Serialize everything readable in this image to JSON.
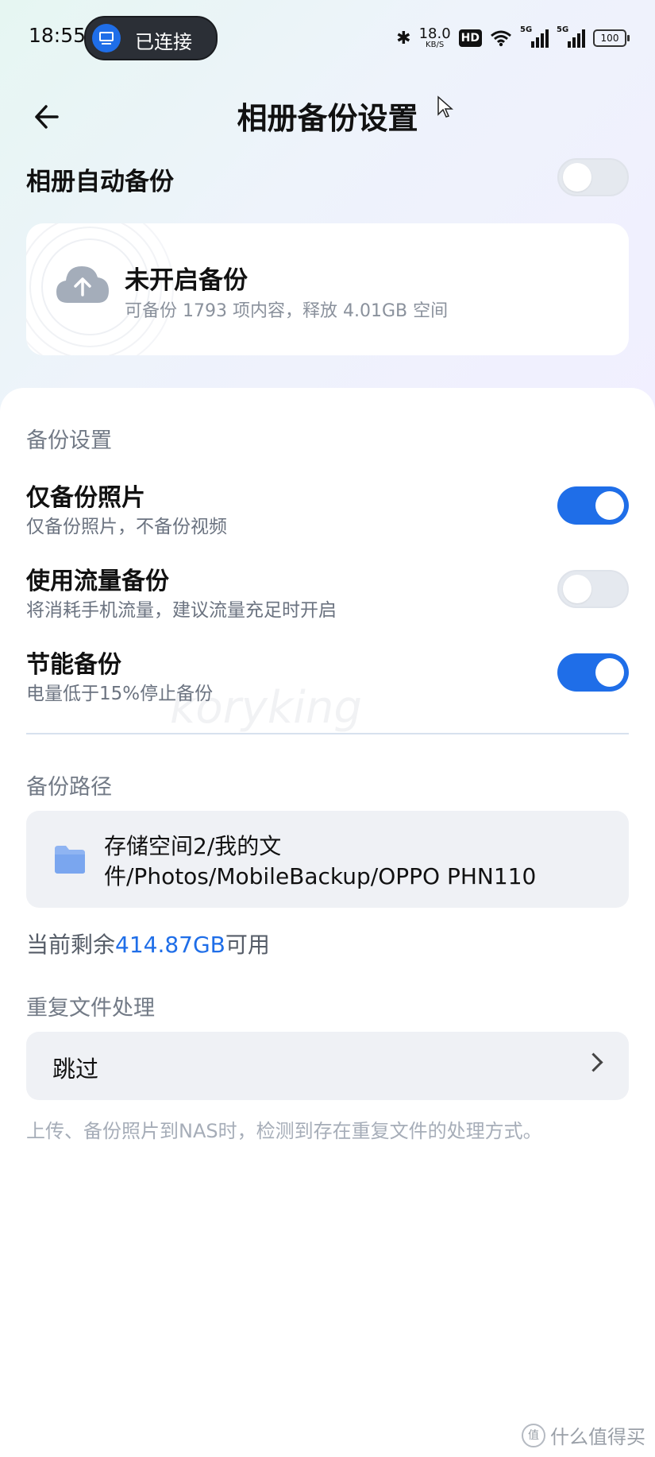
{
  "status_bar": {
    "time": "18:55",
    "connection_label": "已连接",
    "net_speed": "18.0",
    "net_speed_unit": "KB/S",
    "hd_badge": "HD",
    "signal_1": "5G",
    "signal_2": "5G",
    "battery": "100"
  },
  "header": {
    "title": "相册备份设置"
  },
  "auto_backup": {
    "label": "相册自动备份",
    "enabled": false
  },
  "backup_card": {
    "title": "未开启备份",
    "subtitle": "可备份 1793 项内容，释放 4.01GB 空间"
  },
  "settings": {
    "heading": "备份设置",
    "items": [
      {
        "title": "仅备份照片",
        "subtitle": "仅备份照片，不备份视频",
        "enabled": true
      },
      {
        "title": "使用流量备份",
        "subtitle": "将消耗手机流量，建议流量充足时开启",
        "enabled": false
      },
      {
        "title": "节能备份",
        "subtitle": "电量低于15%停止备份",
        "enabled": true
      }
    ]
  },
  "backup_path": {
    "heading": "备份路径",
    "path": "存储空间2/我的文件/Photos/MobileBackup/OPPO PHN110",
    "remain_prefix": "当前剩余",
    "remain_value": "414.87GB",
    "remain_suffix": "可用"
  },
  "duplicate": {
    "heading": "重复文件处理",
    "value": "跳过",
    "note": "上传、备份照片到NAS时，检测到存在重复文件的处理方式。"
  },
  "watermark": {
    "text": "koryking",
    "site": "什么值得买"
  },
  "colors": {
    "accent": "#1f6ee8",
    "toggle_off": "#e5e9ef",
    "box_bg": "#eff1f5"
  }
}
